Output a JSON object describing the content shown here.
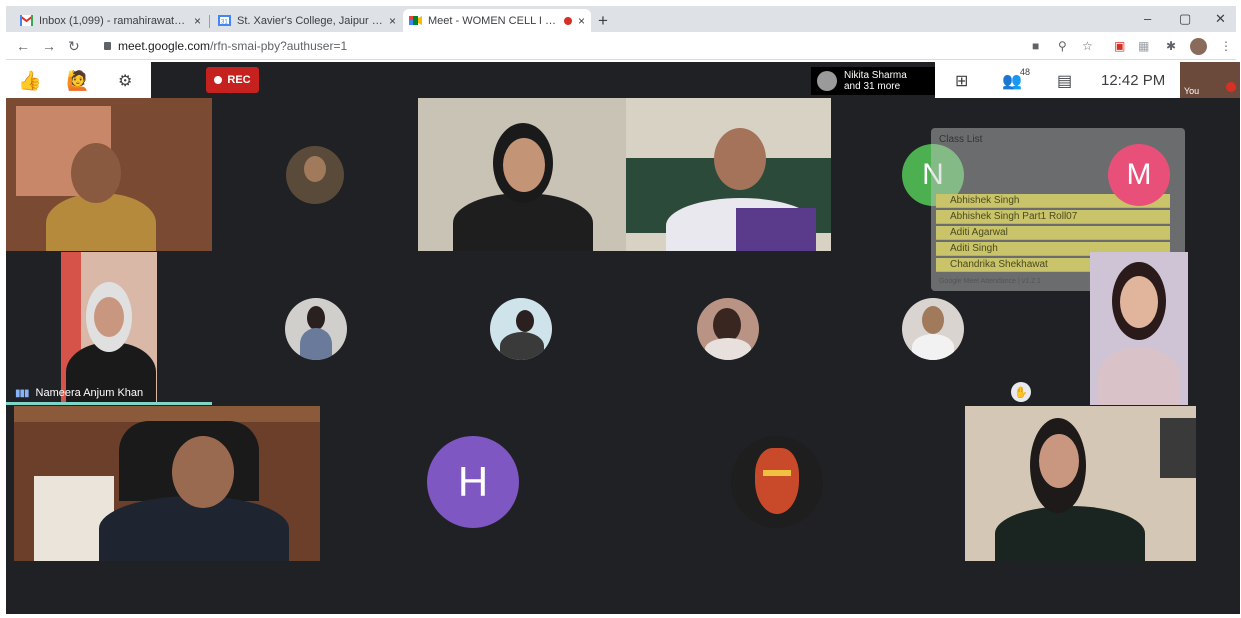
{
  "browser": {
    "tabs": [
      {
        "title": "Inbox (1,099) - ramahirawat@st...",
        "favicon": "gmail-icon",
        "active": false
      },
      {
        "title": "St. Xavier's College, Jaipur - Cale...",
        "favicon": "calendar-icon",
        "active": false
      },
      {
        "title": "Meet - WOMEN CELL I IDEN...",
        "favicon": "meet-icon",
        "active": true,
        "recording": true
      }
    ],
    "new_tab_symbol": "+",
    "tab_close_symbol": "×",
    "window_controls": {
      "minimize": "–",
      "maximize": "▢",
      "close": "✕"
    },
    "url_host": "meet.google.com",
    "url_path": "/rfn-smai-pby?authuser=1"
  },
  "meet": {
    "rec_label": "REC",
    "presenter": {
      "name": "Nikita Sharma",
      "more": "and 31 more"
    },
    "participant_count": "48",
    "time": "12:42 PM",
    "self_label": "You",
    "reaction_icon": "thumbs-up-icon",
    "speaking_name": "Nameera Anjum Khan",
    "avatar_letters": {
      "n": "N",
      "m": "M",
      "h": "H"
    },
    "colors": {
      "background": "#202124",
      "n_avatar": "#4caf50",
      "m_avatar": "#e8507a",
      "h_avatar": "#7e57c2",
      "rec": "#c5221f"
    },
    "class_list": {
      "title": "Class List",
      "rows": [
        "Abhishek Singh",
        "Abhishek Singh Part1 Roll07",
        "Aditi Agarwal",
        "Aditi Singh",
        "Chandrika Shekhawat"
      ],
      "footer": "Google Meet Attendance | v1.2.1"
    }
  }
}
